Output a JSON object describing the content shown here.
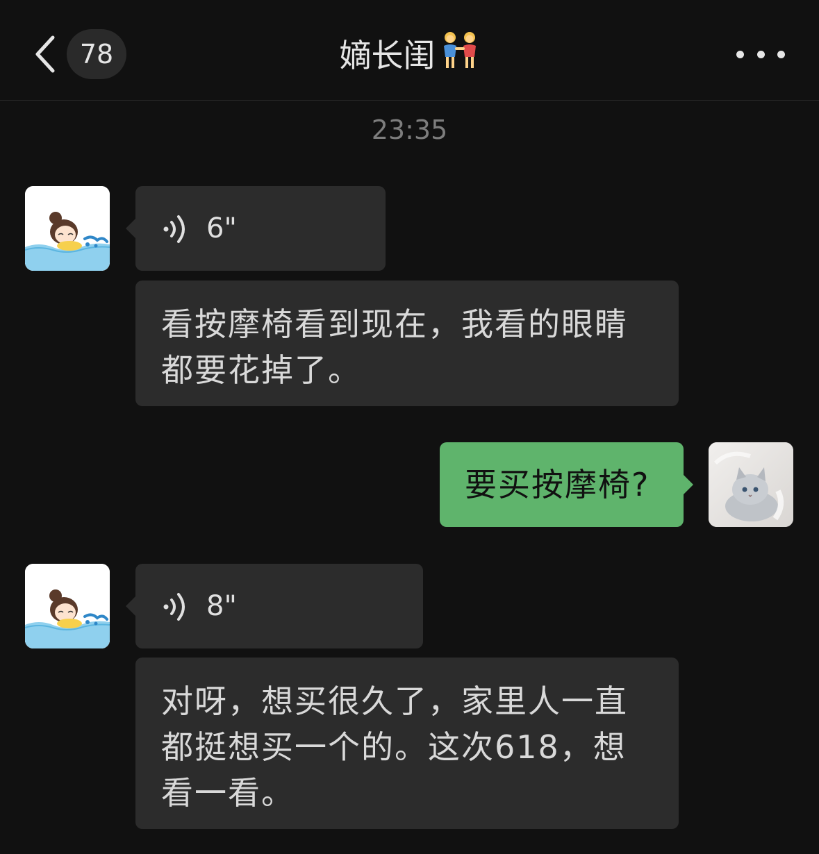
{
  "header": {
    "back_icon": "chevron-left-icon",
    "unread_count": "78",
    "title": "嫡长闺",
    "title_emoji": "two-women-holding-hands-emoji",
    "more_icon": "more-dots-icon"
  },
  "chat": {
    "timestamp": "23:35",
    "messages": [
      {
        "sender": "other",
        "type": "voice",
        "duration": "6\""
      },
      {
        "sender": "other",
        "type": "text",
        "text": "看按摩椅看到现在，我看的眼睛都要花掉了。"
      },
      {
        "sender": "me",
        "type": "text",
        "text": "要买按摩椅?"
      },
      {
        "sender": "other",
        "type": "voice",
        "duration": "8\""
      },
      {
        "sender": "other",
        "type": "text",
        "text": "对呀，想买很久了，家里人一直都挺想买一个的。这次618，想看一看。"
      }
    ]
  },
  "colors": {
    "background": "#111111",
    "bubble_in": "#2c2c2c",
    "bubble_out": "#5fb46c",
    "timestamp": "#7d7d7d"
  }
}
